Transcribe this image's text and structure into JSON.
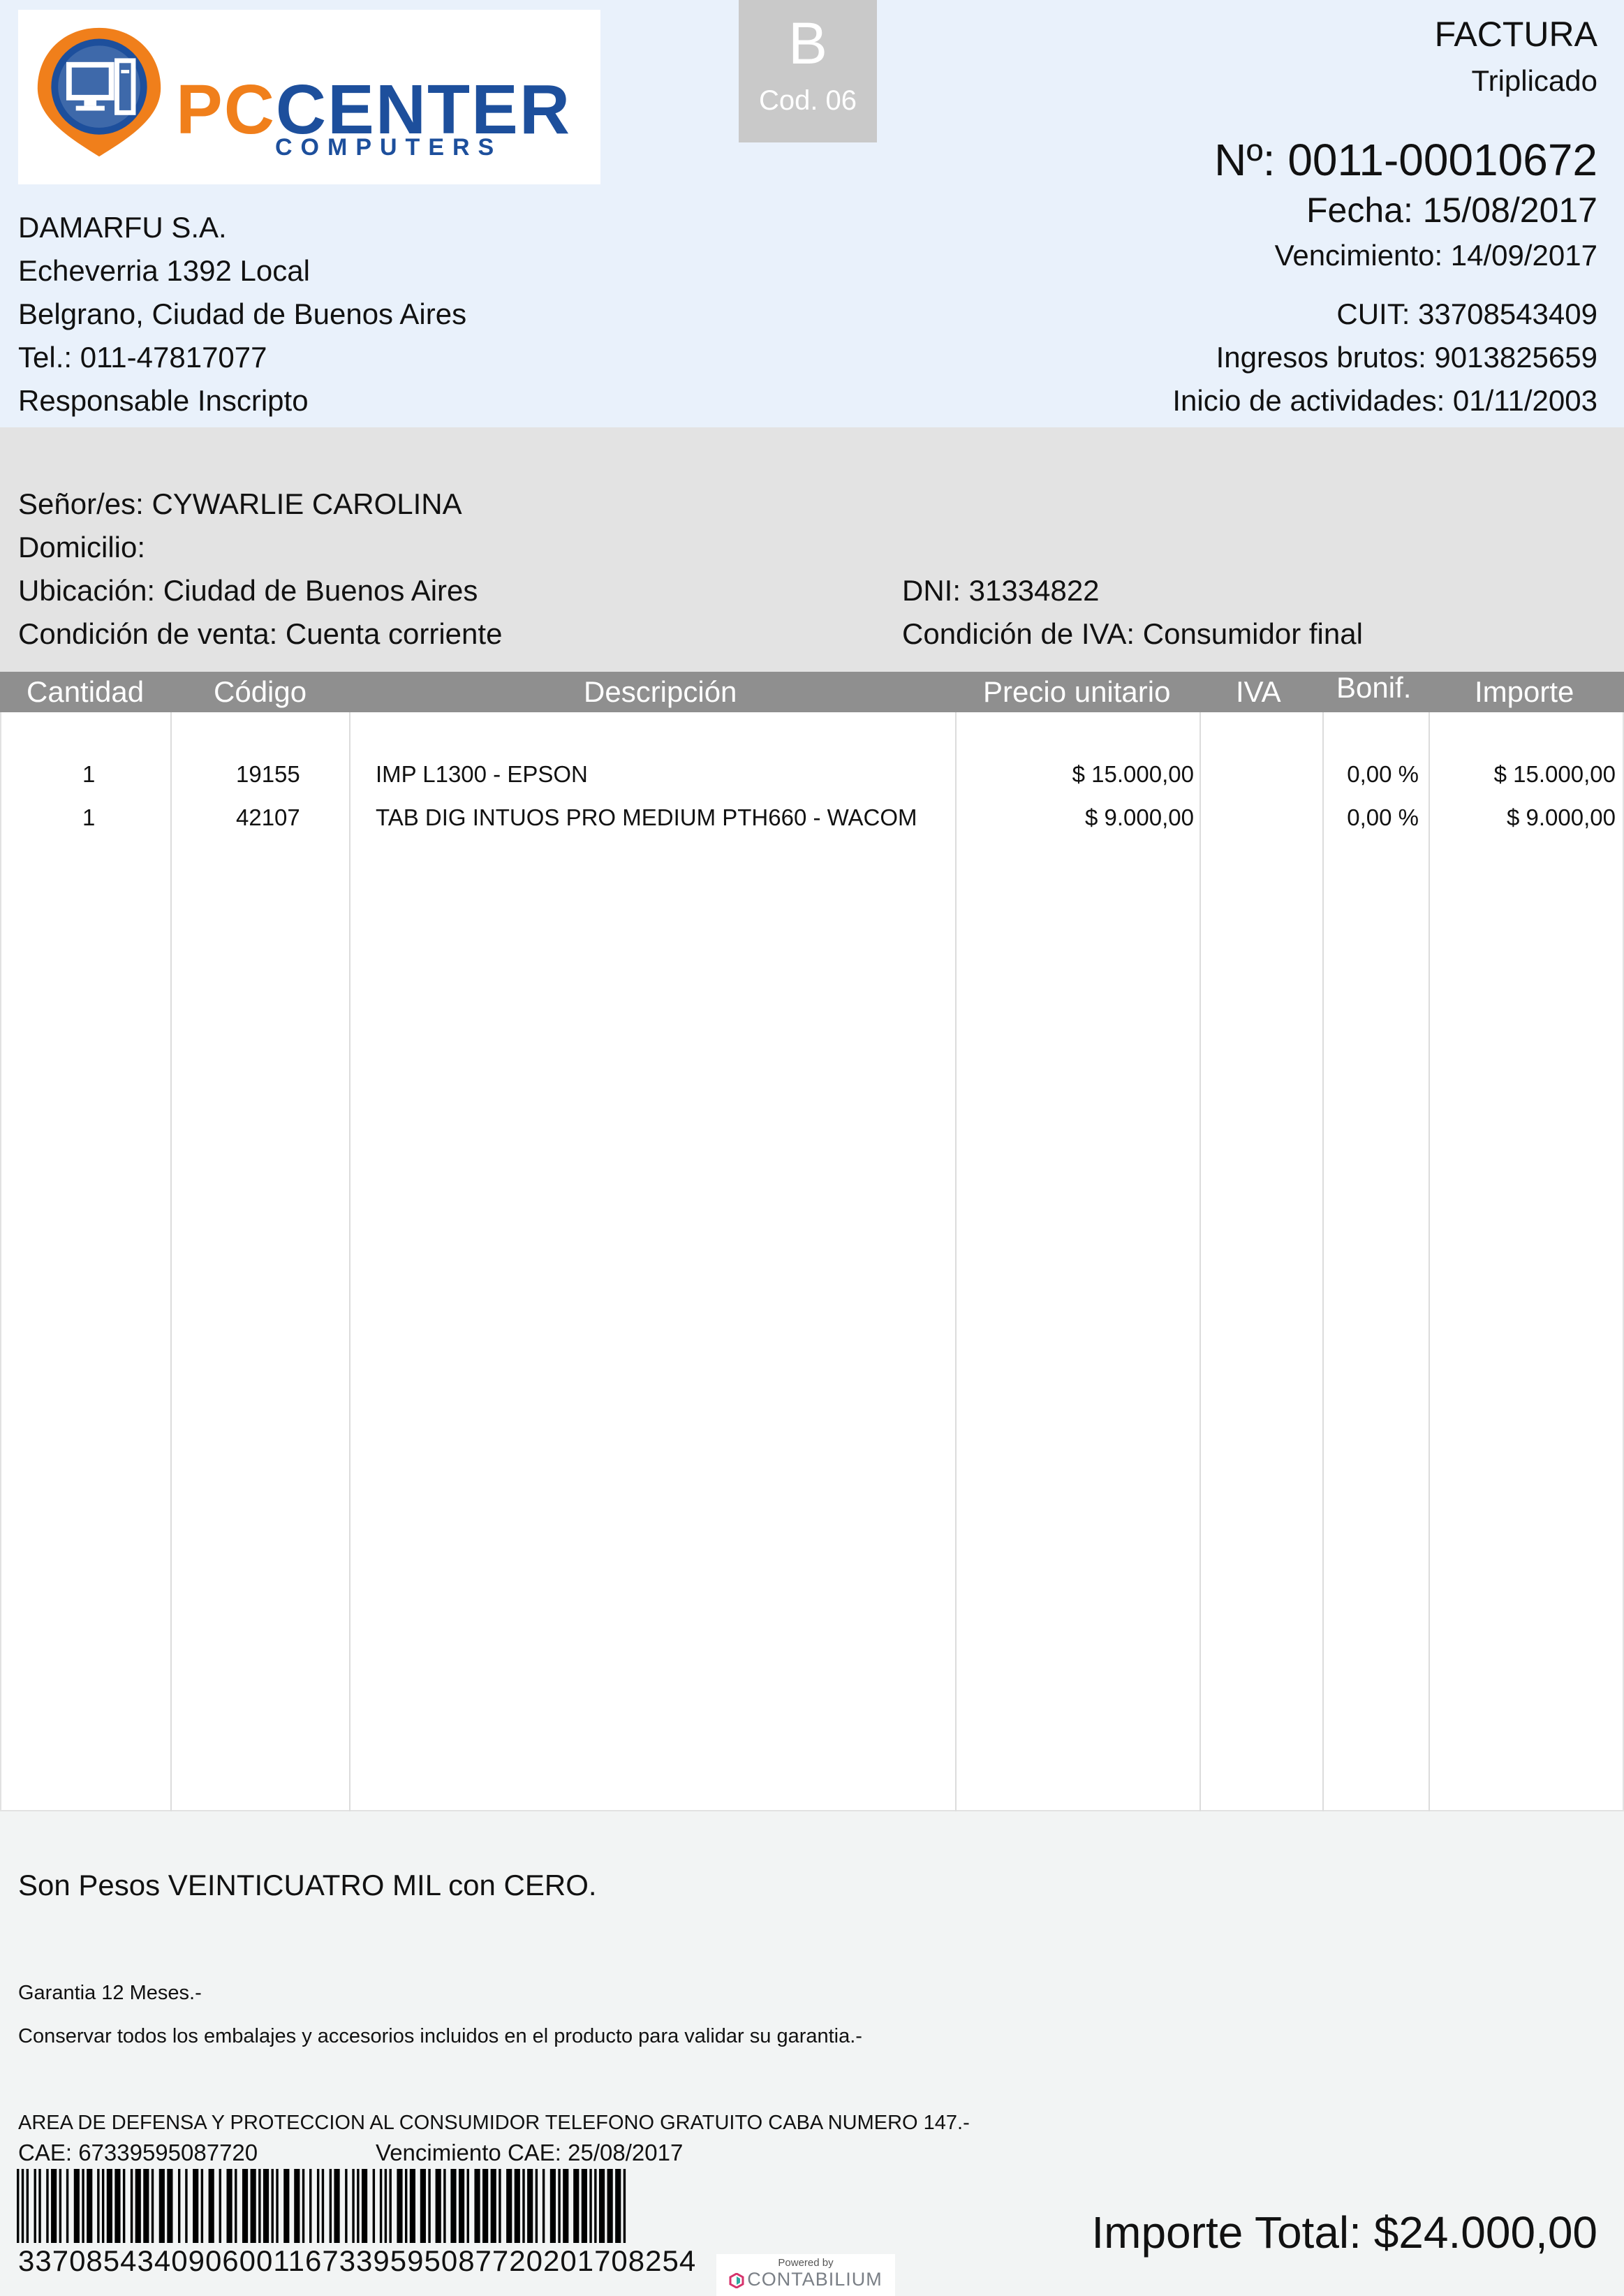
{
  "header": {
    "logo_word_1": "PC",
    "logo_word_2": "CENTER",
    "logo_sub": "COMPUTERS",
    "type_letter": "B",
    "type_code": "Cod. 06",
    "doc_title": "FACTURA",
    "doc_copy": "Triplicado",
    "number": "Nº: 0011-00010672",
    "date": "Fecha: 15/08/2017",
    "due_date": "Vencimiento: 14/09/2017",
    "cuit": "CUIT: 33708543409",
    "gross_income": "Ingresos brutos: 9013825659",
    "activity_start": "Inicio de actividades: 01/11/2003"
  },
  "company": {
    "name": "DAMARFU S.A.",
    "address": "Echeverria 1392 Local",
    "city": "Belgrano, Ciudad de Buenos Aires",
    "phone": "Tel.: 011-47817077",
    "tax_status": "Responsable Inscripto"
  },
  "client": {
    "name": "Señor/es: CYWARLIE CAROLINA",
    "address": "Domicilio:",
    "location": "Ubicación:  Ciudad de Buenos Aires",
    "dni": "DNI: 31334822",
    "sale_condition": "Condición de venta: Cuenta corriente",
    "vat_condition": "Condición de IVA: Consumidor final"
  },
  "table": {
    "headers": [
      "Cantidad",
      "Código",
      "Descripción",
      "Precio unitario",
      "IVA",
      "Bonif.",
      "Importe"
    ],
    "rows": [
      {
        "quantity": "1",
        "code": "19155",
        "description": "IMP L1300  - EPSON",
        "unit_price": "$ 15.000,00",
        "discount": "0,00 %",
        "amount": "$ 15.000,00"
      },
      {
        "quantity": "1",
        "code": "42107",
        "description": "TAB DIG INTUOS PRO MEDIUM PTH660 - WACOM",
        "unit_price": "$ 9.000,00",
        "discount": "0,00 %",
        "amount": "$ 9.000,00"
      }
    ]
  },
  "footer": {
    "amount_words": "Son Pesos VEINTICUATRO MIL con CERO.",
    "warranty": "Garantia 12 Meses.-",
    "conditions": "Conservar todos los embalajes y accesorios incluidos en el producto para validar su garantia.-",
    "consumer_protection": "AREA DE DEFENSA Y PROTECCION AL CONSUMIDOR TELEFONO GRATUITO CABA NUMERO 147.-",
    "cae": "CAE: 67339595087720",
    "cae_due": "Vencimiento CAE: 25/08/2017",
    "barcode_number": "33708543409060011673395950877202017082​54",
    "powered_by": "Powered by",
    "powered_brand": "CONTABILIUM",
    "total": "Importe Total: $24.000,00"
  }
}
